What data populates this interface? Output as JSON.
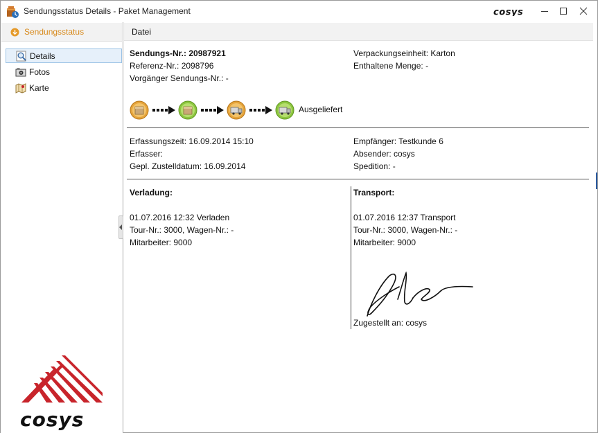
{
  "window": {
    "title": "Sendungsstatus Details - Paket Management",
    "brand": "cosys"
  },
  "sidebar": {
    "header": "Sendungsstatus",
    "items": [
      {
        "label": "Details",
        "icon": "magnifier-icon",
        "selected": true
      },
      {
        "label": "Fotos",
        "icon": "camera-icon",
        "selected": false
      },
      {
        "label": "Karte",
        "icon": "map-icon",
        "selected": false
      }
    ],
    "logo_text": "cosys"
  },
  "menu": {
    "datei": "Datei"
  },
  "shipment": {
    "sendungs_nr_label": "Sendungs-Nr.:",
    "sendungs_nr_value": "20987921",
    "referenz_label": "Referenz-Nr.:",
    "referenz_value": "2098796",
    "vorgaenger": "Vorgänger Sendungs-Nr.: -",
    "verpackung": "Verpackungseinheit: Karton",
    "menge": "Enthaltene Menge: -"
  },
  "status_flow": {
    "steps": [
      "package-orange-icon",
      "package-green-icon",
      "truck-orange-icon",
      "truck-green-icon"
    ],
    "final_label": "Ausgeliefert"
  },
  "meta": {
    "erfassungszeit_label": "Erfassungszeit:",
    "erfassungszeit_value": "16.09.2014 15:10",
    "erfasser": "Erfasser:",
    "zustelldatum_label": "Gepl. Zustelldatum:",
    "zustelldatum_value": "16.09.2014",
    "empfaenger": "Empfänger: Testkunde 6",
    "absender": "Absender: cosys",
    "spedition": "Spedition: -"
  },
  "verladung": {
    "title": "Verladung:",
    "line1": "01.07.2016 12:32 Verladen",
    "line2": "Tour-Nr.: 3000, Wagen-Nr.: -",
    "line3": "Mitarbeiter: 9000"
  },
  "transport": {
    "title": "Transport:",
    "line1": "01.07.2016 12:37 Transport",
    "line2": "Tour-Nr.: 3000, Wagen-Nr.: -",
    "line3": "Mitarbeiter: 9000",
    "zugestellt": "Zugestellt an:  cosys"
  },
  "colors": {
    "accent_orange": "#d88a1c",
    "selection_bg": "#e6f0fa",
    "logo_red": "#c8242b"
  }
}
